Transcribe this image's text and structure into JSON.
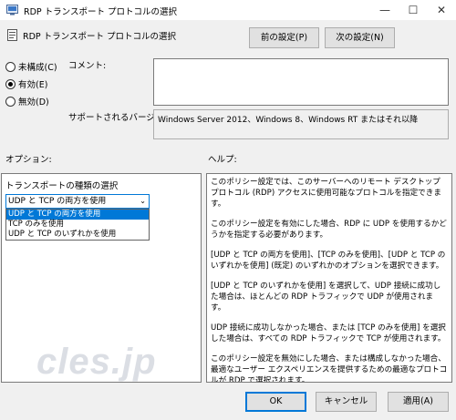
{
  "window": {
    "title": "RDP トランスポート プロトコルの選択",
    "minimize_glyph": "—",
    "maximize_glyph": "☐",
    "close_glyph": "✕"
  },
  "header": {
    "policy_title": "RDP トランスポート プロトコルの選択",
    "prev_button": "前の設定(P)",
    "next_button": "次の設定(N)"
  },
  "state": {
    "unconfigured": "未構成(C)",
    "enabled": "有効(E)",
    "disabled": "無効(D)",
    "selected": "enabled"
  },
  "comment": {
    "label": "コメント:",
    "value": ""
  },
  "supported": {
    "label": "サポートされるバージョン:",
    "value": "Windows Server 2012、Windows 8、Windows RT またはそれ以降"
  },
  "options": {
    "label": "オプション:",
    "transport_label": "トランスポートの種類の選択",
    "selected_value": "UDP と TCP の両方を使用",
    "items": [
      "UDP と TCP の両方を使用",
      "TCP のみを使用",
      "UDP と TCP のいずれかを使用"
    ]
  },
  "help": {
    "label": "ヘルプ:",
    "paragraphs": [
      "このポリシー設定では、このサーバーへのリモート デスクトップ プロトコル (RDP) アクセスに使用可能なプロトコルを指定できます。",
      "このポリシー設定を有効にした場合、RDP に UDP を使用するかどうかを指定する必要があります。",
      "[UDP と TCP の両方を使用]、[TCP のみを使用]、[UDP と TCP のいずれかを使用] (既定) のいずれかのオプションを選択できます。",
      "[UDP と TCP のいずれかを使用] を選択して、UDP 接続に成功した場合は、ほとんどの RDP トラフィックで UDP が使用されます。",
      "UDP 接続に成功しなかった場合、または [TCP のみを使用] を選択した場合は、すべての RDP トラフィックで TCP が使用されます。",
      "このポリシー設定を無効にした場合、または構成しなかった場合、最適なユーザー エクスペリエンスを提供するための最適なプロトコルが RDP で選択されます。"
    ]
  },
  "footer": {
    "ok": "OK",
    "cancel": "キャンセル",
    "apply": "適用(A)"
  },
  "watermark": "cles.jp",
  "colors": {
    "accent": "#0078d7",
    "background": "#f0f0f0"
  }
}
